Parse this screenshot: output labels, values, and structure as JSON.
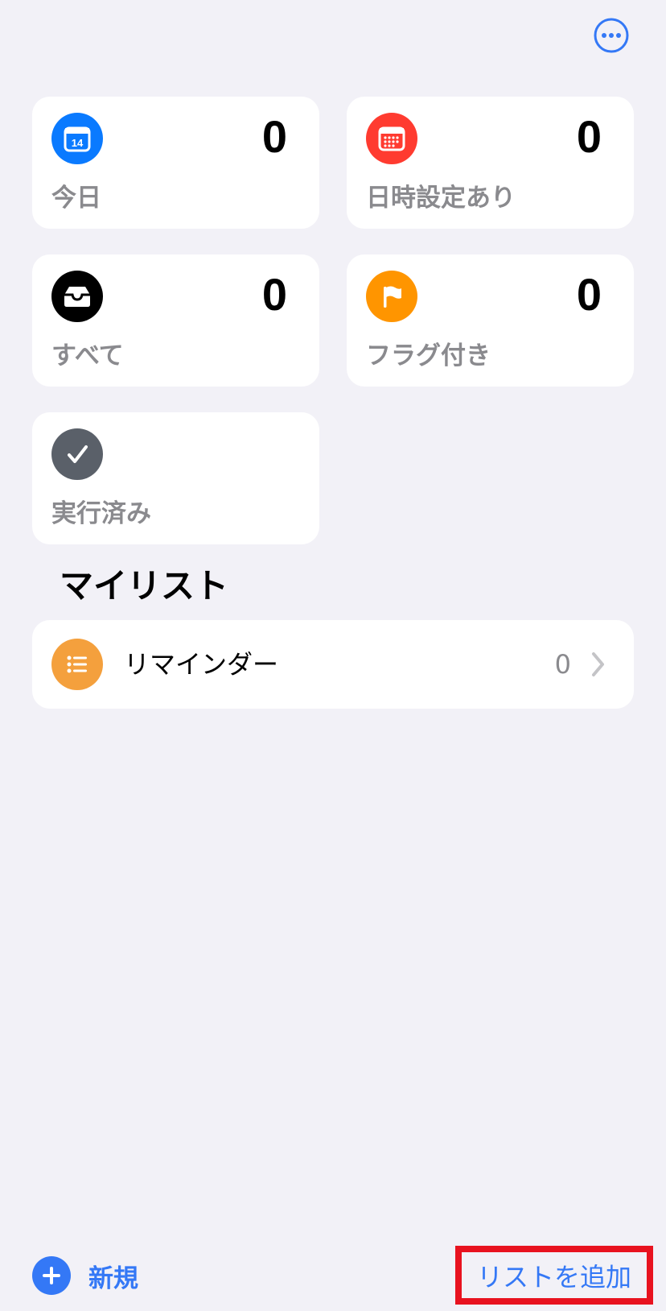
{
  "header": {
    "more_icon": "ellipsis-circle-icon"
  },
  "smart_lists": [
    {
      "label": "今日",
      "count": "0",
      "icon": "calendar-today-icon",
      "icon_text": "14",
      "color": "#0a7aff"
    },
    {
      "label": "日時設定あり",
      "count": "0",
      "icon": "calendar-grid-icon",
      "color": "#ff3b30"
    },
    {
      "label": "すべて",
      "count": "0",
      "icon": "tray-icon",
      "color": "#000000"
    },
    {
      "label": "フラグ付き",
      "count": "0",
      "icon": "flag-icon",
      "color": "#ff9500"
    },
    {
      "label": "実行済み",
      "icon": "checkmark-icon",
      "color": "#5a6069"
    }
  ],
  "my_lists": {
    "title": "マイリスト",
    "items": [
      {
        "name": "リマインダー",
        "count": "0",
        "icon": "list-bullet-icon",
        "color": "#f4a03d"
      }
    ]
  },
  "toolbar": {
    "new_label": "新規",
    "add_list_label": "リストを追加",
    "accent": "#3478f6",
    "highlight": "#e8121f"
  }
}
